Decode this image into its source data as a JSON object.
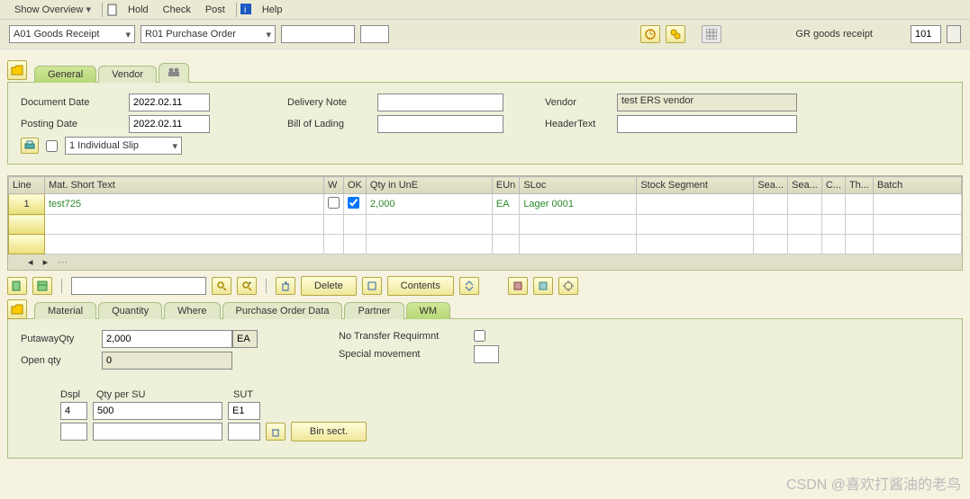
{
  "menu": {
    "show_overview": "Show Overview",
    "hold": "Hold",
    "check": "Check",
    "post": "Post",
    "help": "Help"
  },
  "toolbar": {
    "goods_receipt": "A01 Goods Receipt",
    "purchase_order": "R01 Purchase Order",
    "gr_label": "GR goods receipt",
    "gr_code": "101"
  },
  "tabs1": {
    "general": "General",
    "vendor": "Vendor"
  },
  "header": {
    "doc_date_label": "Document Date",
    "doc_date": "2022.02.11",
    "posting_date_label": "Posting Date",
    "posting_date": "2022.02.11",
    "delivery_note_label": "Delivery Note",
    "bill_lading_label": "Bill of Lading",
    "vendor_label": "Vendor",
    "vendor_value": "test ERS vendor",
    "header_text_label": "HeaderText",
    "slip": "1 Individual Slip"
  },
  "table": {
    "cols": {
      "line": "Line",
      "mat": "Mat. Short Text",
      "w": "W",
      "ok": "OK",
      "qty": "Qty in UnE",
      "eun": "EUn",
      "sloc": "SLoc",
      "sseg": "Stock Segment",
      "sea": "Sea...",
      "sea2": "Sea...",
      "c": "C...",
      "th": "Th...",
      "batch": "Batch"
    },
    "row": {
      "line": "1",
      "mat": "test725",
      "qty": "2,000",
      "eun": "EA",
      "sloc": "Lager 0001"
    }
  },
  "actions": {
    "delete": "Delete",
    "contents": "Contents"
  },
  "tabs2": {
    "material": "Material",
    "quantity": "Quantity",
    "where": "Where",
    "pod": "Purchase Order Data",
    "partner": "Partner",
    "wm": "WM"
  },
  "wm": {
    "putaway_label": "PutawayQty",
    "putaway_val": "2,000",
    "putaway_unit": "EA",
    "open_label": "Open qty",
    "open_val": "0",
    "no_transfer": "No Transfer Requirmnt",
    "spec_mov": "Special movement",
    "dspl": "Dspl",
    "dspl_val": "4",
    "qtysu": "Qty per SU",
    "qtysu_val": "500",
    "sut": "SUT",
    "sut_val": "E1",
    "bin": "Bin sect."
  },
  "watermark": "CSDN @喜欢打酱油的老鸟"
}
